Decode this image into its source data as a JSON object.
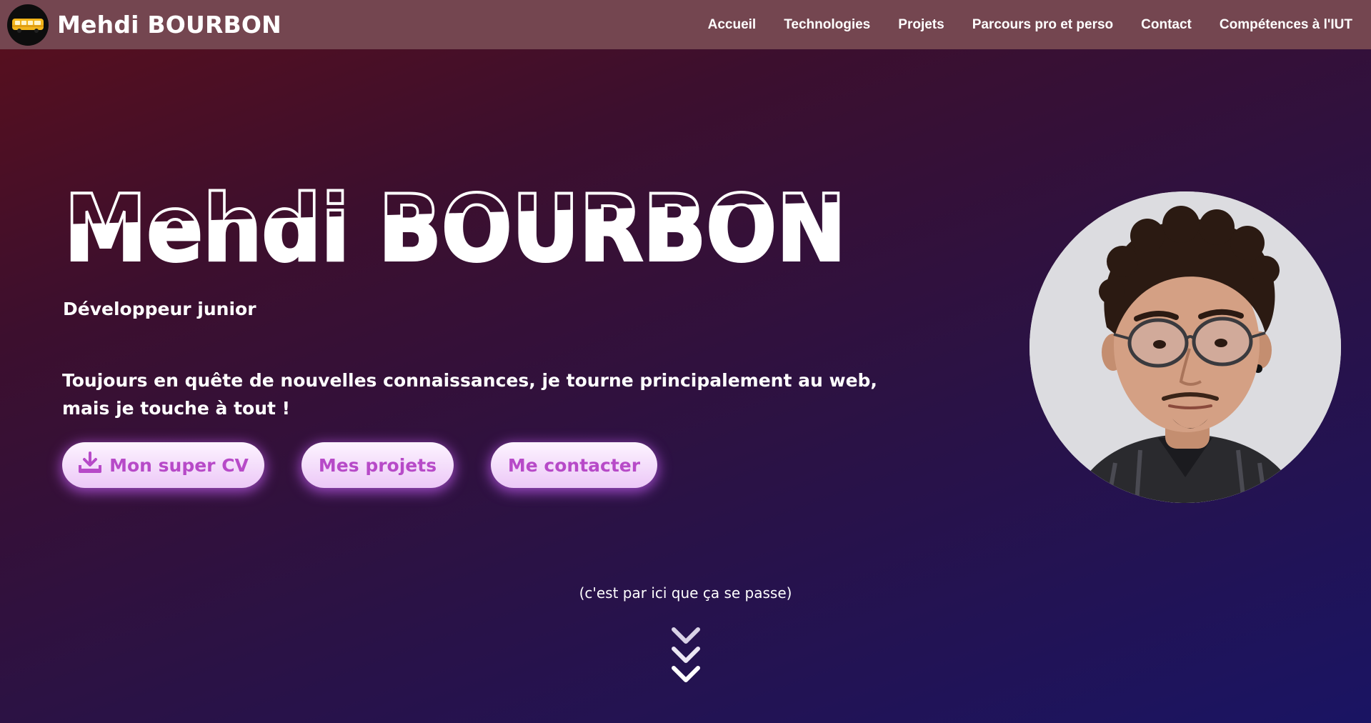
{
  "header": {
    "brand_name": "Mehdi BOURBON",
    "logo_icon": "yellow-bus-icon",
    "nav": [
      {
        "label": "Accueil"
      },
      {
        "label": "Technologies"
      },
      {
        "label": "Projets"
      },
      {
        "label": "Parcours pro et perso"
      },
      {
        "label": "Contact"
      },
      {
        "label": "Compétences à l'IUT"
      }
    ]
  },
  "hero": {
    "title": "Mehdi BOURBON",
    "subtitle": "Développeur junior",
    "tagline": "Toujours en quête de nouvelles connaissances, je tourne principalement au web, mais je touche à tout !",
    "buttons": {
      "cv": {
        "label": "Mon super CV",
        "icon": "download-icon"
      },
      "projects": {
        "label": "Mes projets"
      },
      "contact": {
        "label": "Me contacter"
      }
    },
    "avatar_icon": "profile-photo"
  },
  "scroll": {
    "hint": "(c'est par ici que ça se passe)",
    "icon": "chevrons-down-icon"
  },
  "colors": {
    "nav_background": "#744650",
    "gradient_top_left": "#5a0f1c",
    "gradient_bottom_right": "#1a1463",
    "button_text": "#b74ac8",
    "button_glow": "#be5aeb"
  }
}
